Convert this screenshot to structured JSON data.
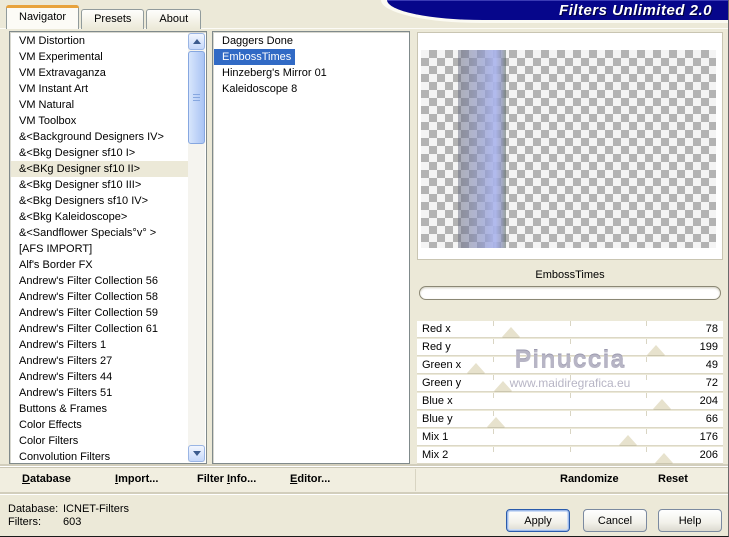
{
  "window": {
    "banner_title": "Filters Unlimited 2.0"
  },
  "tabs": [
    {
      "label": "Navigator",
      "active": true
    },
    {
      "label": "Presets",
      "active": false
    },
    {
      "label": "About",
      "active": false
    }
  ],
  "category_list": {
    "selected_index": 8,
    "items": [
      "VM Distortion",
      "VM Experimental",
      "VM Extravaganza",
      "VM Instant Art",
      "VM Natural",
      "VM Toolbox",
      "&<Background Designers IV>",
      "&<Bkg Designer sf10 I>",
      "&<BKg Designer sf10 II>",
      "&<Bkg Designer sf10 III>",
      "&<Bkg Designers sf10 IV>",
      "&<Bkg Kaleidoscope>",
      "&<Sandflower Specials°v° >",
      "[AFS IMPORT]",
      "Alf's Border FX",
      "Andrew's Filter Collection 56",
      "Andrew's Filter Collection 58",
      "Andrew's Filter Collection 59",
      "Andrew's Filter Collection 61",
      "Andrew's Filters 1",
      "Andrew's Filters 27",
      "Andrew's Filters 44",
      "Andrew's Filters 51",
      "Buttons & Frames",
      "Color Effects",
      "Color Filters",
      "Convolution Filters"
    ]
  },
  "filter_list": {
    "selected_index": 1,
    "items": [
      "Daggers Done",
      "EmbossTimes",
      "Hinzeberg's Mirror 01",
      "Kaleidoscope 8"
    ]
  },
  "preview": {
    "filter_name": "EmbossTimes",
    "progress_percent": 0
  },
  "sliders": {
    "max": 255,
    "rows": [
      {
        "label": "Red x",
        "value": 78
      },
      {
        "label": "Red y",
        "value": 199
      },
      {
        "label": "Green x",
        "value": 49
      },
      {
        "label": "Green y",
        "value": 72
      },
      {
        "label": "Blue x",
        "value": 204
      },
      {
        "label": "Blue y",
        "value": 66
      },
      {
        "label": "Mix 1",
        "value": 176
      },
      {
        "label": "Mix 2",
        "value": 206
      }
    ]
  },
  "watermark": {
    "line1": "Pinuccia",
    "line2": "www.maidiregrafica.eu"
  },
  "menu": {
    "items": [
      {
        "pre": "",
        "key": "D",
        "post": "atabase"
      },
      {
        "pre": "",
        "key": "I",
        "post": "mport..."
      },
      {
        "pre": "Filter ",
        "key": "I",
        "post": "nfo..."
      },
      {
        "pre": "",
        "key": "E",
        "post": "ditor..."
      }
    ],
    "randomize_label": "Randomize",
    "reset_label": "Reset"
  },
  "status": {
    "database_label": "Database:",
    "database_value": "ICNET-Filters",
    "filters_label": "Filters:",
    "filters_value": "603"
  },
  "dialog_buttons": {
    "apply": "Apply",
    "cancel": "Cancel",
    "help": "Help"
  },
  "colors": {
    "dialog_bg": "#ece9d8",
    "banner_bg": "#06068b",
    "selection_blue": "#316ac5",
    "soft_selection": "#ece9d8",
    "active_tab_stripe": "#e8a33d"
  }
}
